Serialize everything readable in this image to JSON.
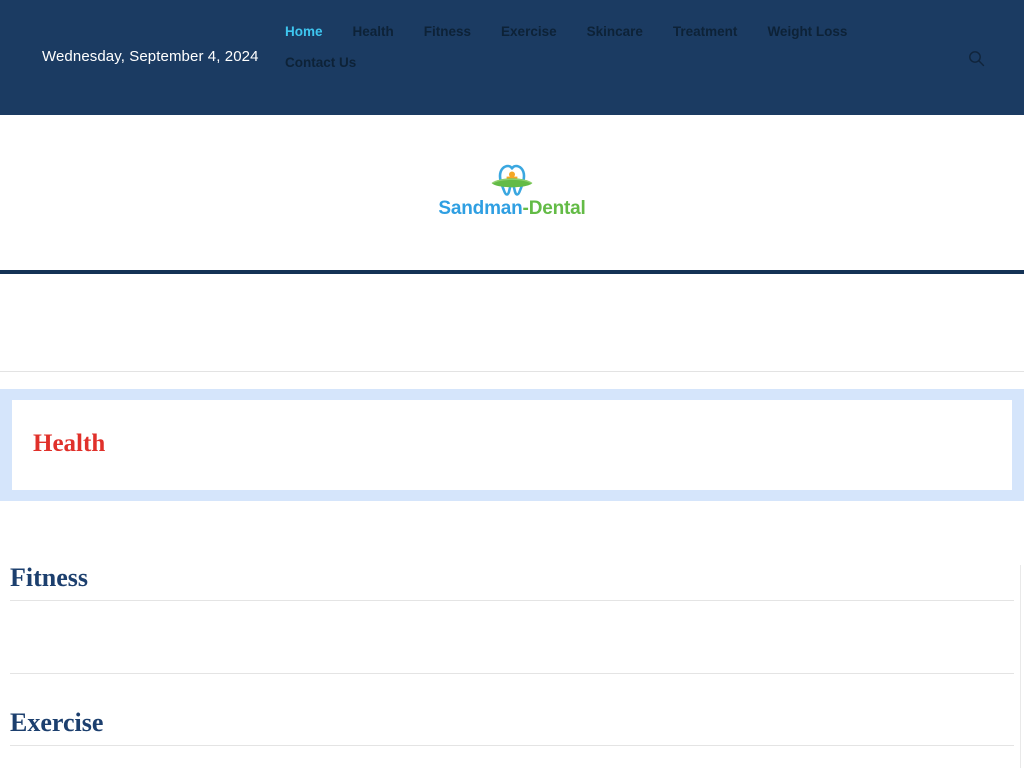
{
  "header": {
    "background_color": "#1b3b62",
    "date": "Wednesday, September 4, 2024",
    "search_icon": "search-icon",
    "nav": {
      "items": [
        {
          "label": "Home",
          "active": true
        },
        {
          "label": "Health",
          "active": false
        },
        {
          "label": "Fitness",
          "active": false
        },
        {
          "label": "Exercise",
          "active": false
        },
        {
          "label": "Skincare",
          "active": false
        },
        {
          "label": "Treatment",
          "active": false
        },
        {
          "label": "Weight Loss",
          "active": false
        },
        {
          "label": "Contact Us",
          "active": false
        }
      ],
      "active_color": "#3ec6f0",
      "inactive_color": "#0d2237"
    }
  },
  "logo": {
    "icon_name": "tooth-sun-logo-icon",
    "word_primary": "Sandman",
    "word_separator": "-",
    "word_secondary": "Dental",
    "primary_color": "#2f9fe2",
    "secondary_color": "#63bb46",
    "accent_color": "#f5a623"
  },
  "featured": {
    "band_color": "#d5e5fb",
    "title": "Health",
    "title_color": "#e0302a"
  },
  "sections": [
    {
      "title": "Fitness",
      "title_color": "#1c3f6e"
    },
    {
      "title": "Exercise",
      "title_color": "#1c3f6e"
    }
  ]
}
